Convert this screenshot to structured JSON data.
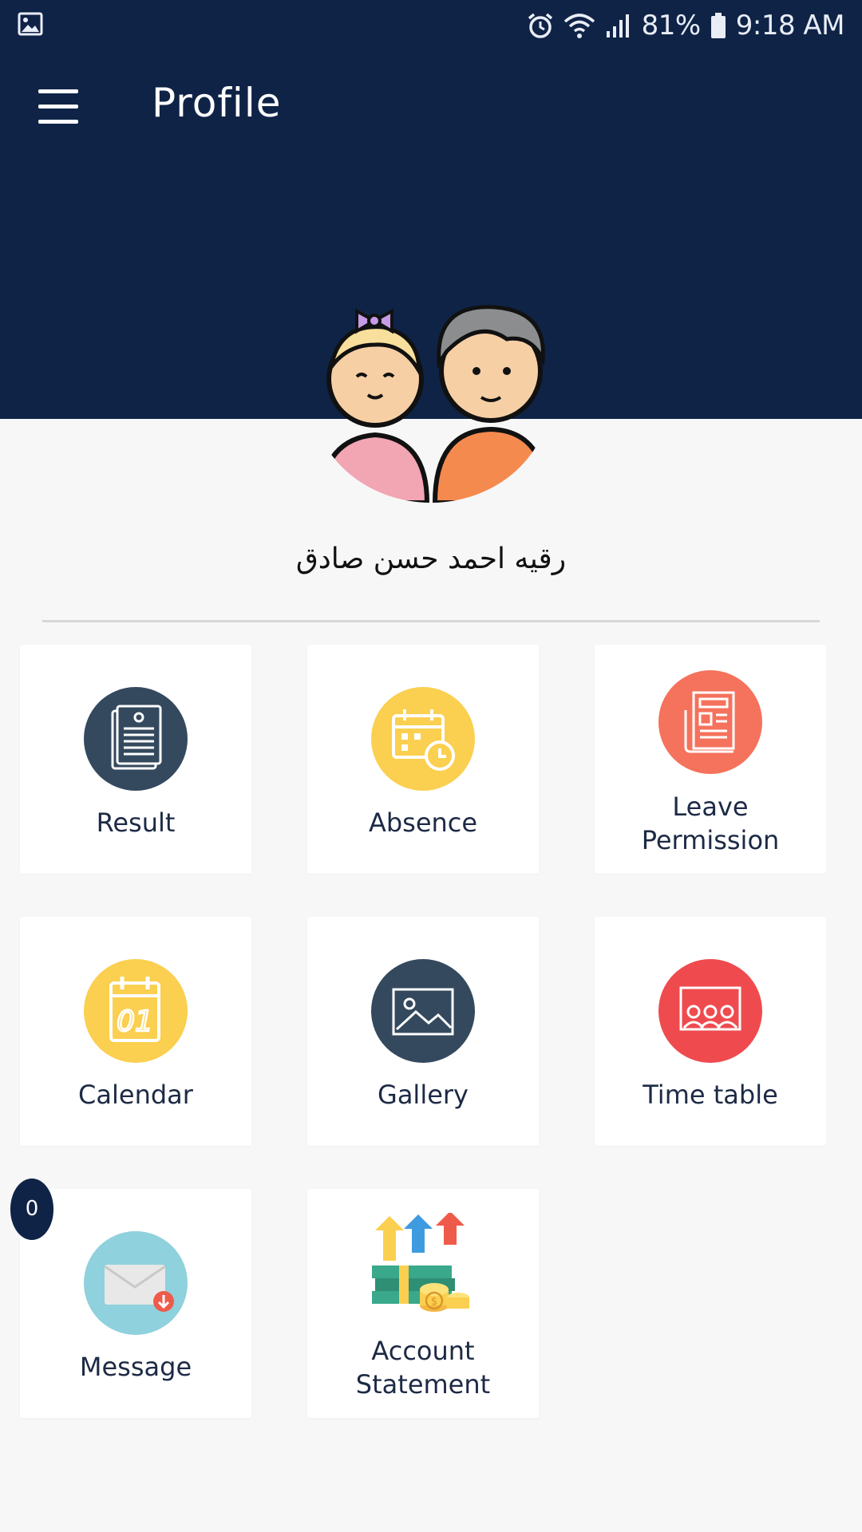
{
  "status_bar": {
    "battery": "81%",
    "time": "9:18 AM"
  },
  "app_bar": {
    "title": "Profile"
  },
  "profile": {
    "name": "رقيه احمد حسن صادق"
  },
  "tiles": [
    {
      "label": "Result",
      "icon": "report-document-icon",
      "color": "#34495e"
    },
    {
      "label": "Absence",
      "icon": "calendar-clock-icon",
      "color": "#fbcf4f"
    },
    {
      "label": "Leave\nPermission",
      "icon": "newspaper-form-icon",
      "color": "#f5725c"
    },
    {
      "label": "Calendar",
      "icon": "calendar-01-icon",
      "color": "#fbcf4f"
    },
    {
      "label": "Gallery",
      "icon": "image-frame-icon",
      "color": "#34495e"
    },
    {
      "label": "Time table",
      "icon": "classroom-board-icon",
      "color": "#ef4b4f"
    },
    {
      "label": "Message",
      "icon": "envelope-download-icon",
      "color": "#8fd1dc"
    },
    {
      "label": "Account\nStatement",
      "icon": "money-growth-icon",
      "color": ""
    }
  ],
  "message_badge": "0"
}
